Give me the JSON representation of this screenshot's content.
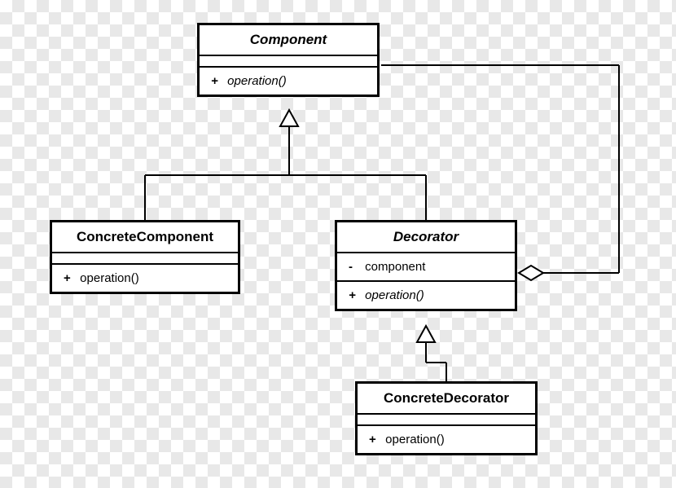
{
  "classes": {
    "component": {
      "name": "Component",
      "op_vis": "+",
      "op_name": "operation()"
    },
    "concreteComponent": {
      "name": "ConcreteComponent",
      "op_vis": "+",
      "op_name": "operation()"
    },
    "decorator": {
      "name": "Decorator",
      "attr_vis": "-",
      "attr_name": "component",
      "op_vis": "+",
      "op_name": "operation()"
    },
    "concreteDecorator": {
      "name": "ConcreteDecorator",
      "op_vis": "+",
      "op_name": "operation()"
    }
  }
}
